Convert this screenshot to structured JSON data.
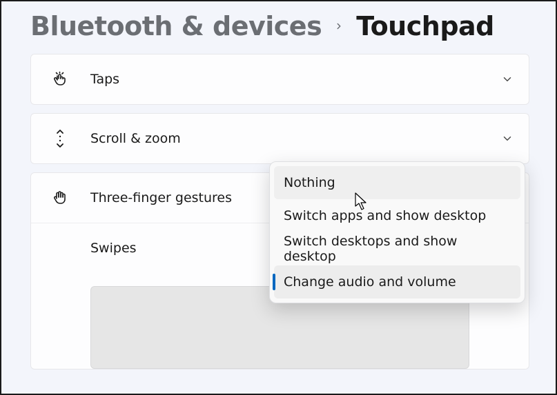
{
  "breadcrumb": {
    "parent": "Bluetooth & devices",
    "current": "Touchpad"
  },
  "sections": {
    "taps": {
      "label": "Taps"
    },
    "scroll_zoom": {
      "label": "Scroll & zoom"
    },
    "three_finger": {
      "label": "Three-finger gestures"
    },
    "swipes": {
      "label": "Swipes"
    }
  },
  "dropdown": {
    "items": [
      {
        "label": "Nothing"
      },
      {
        "label": "Switch apps and show desktop"
      },
      {
        "label": "Switch desktops and show desktop"
      },
      {
        "label": "Change audio and volume"
      }
    ],
    "hover_index": 0,
    "selected_index": 3
  },
  "colors": {
    "accent": "#0067c0"
  }
}
